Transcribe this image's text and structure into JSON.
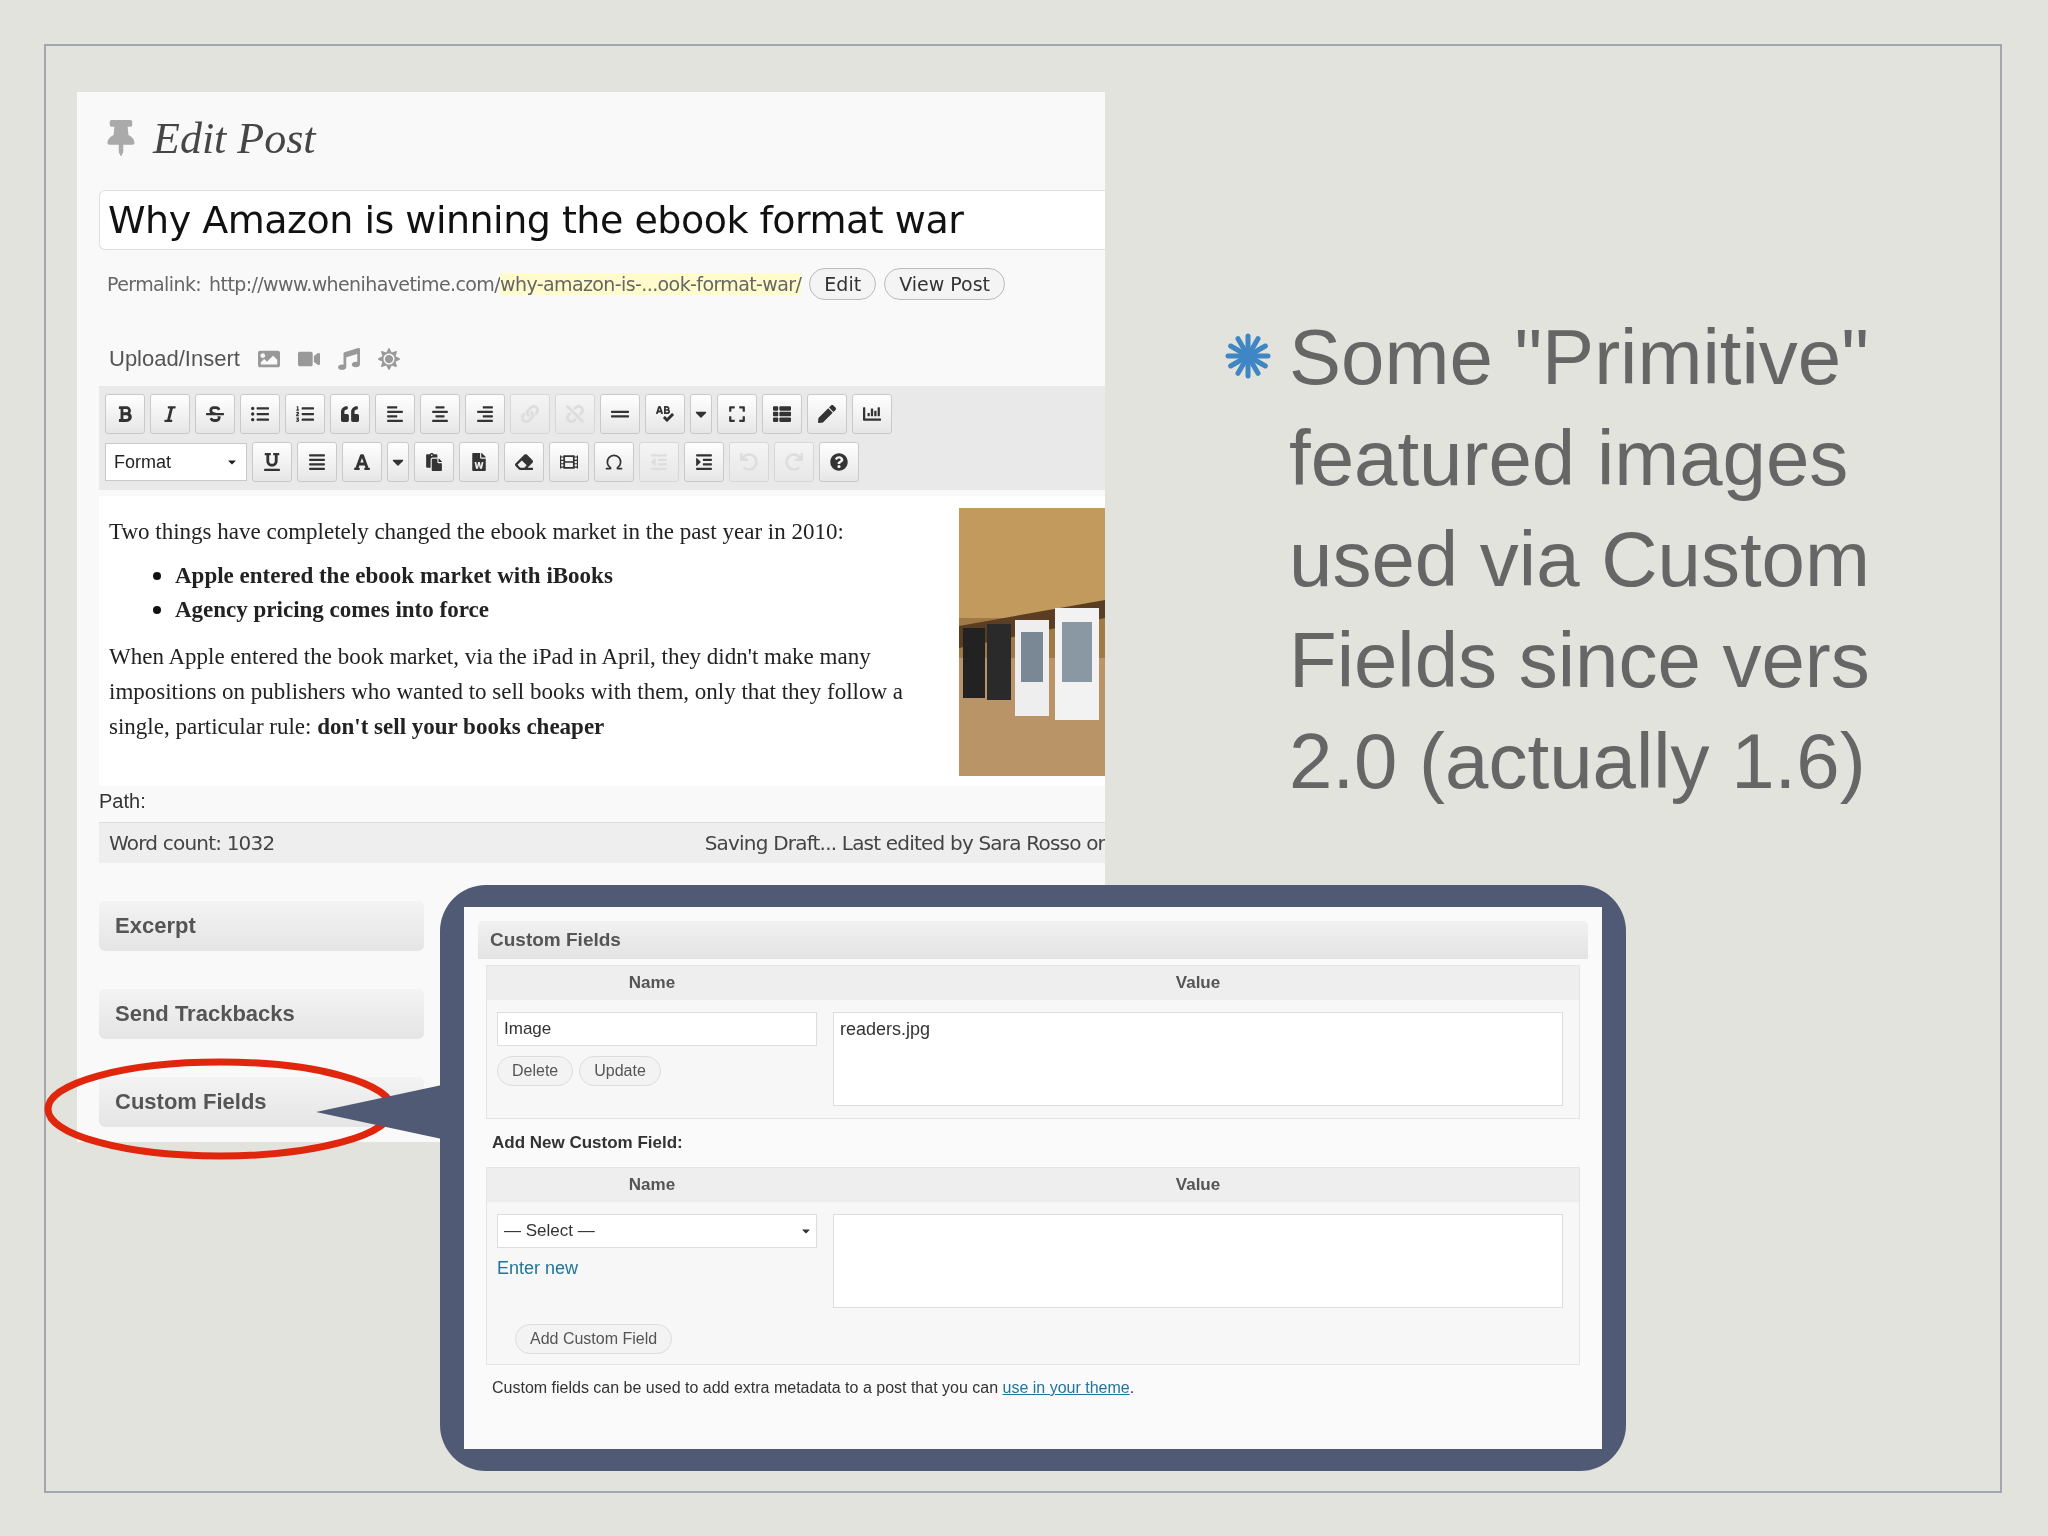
{
  "editor": {
    "heading": "Edit Post",
    "title": "Why Amazon is winning the ebook format war",
    "permalink": {
      "label": "Permalink:",
      "base": "http://www.whenihavetime.com/",
      "slug": "why-amazon-is-...ook-format-war/",
      "buttons": [
        "Edit",
        "View Post"
      ]
    },
    "upload_label": "Upload/Insert",
    "toolbar_rows": [
      [
        {
          "kind": "bold",
          "disabled": false
        },
        {
          "kind": "italic",
          "disabled": false
        },
        {
          "kind": "strike",
          "disabled": false
        },
        {
          "kind": "bullets",
          "disabled": false
        },
        {
          "kind": "numbers",
          "disabled": false
        },
        {
          "kind": "quote",
          "disabled": false
        },
        {
          "kind": "align-left",
          "disabled": false
        },
        {
          "kind": "align-center",
          "disabled": false
        },
        {
          "kind": "align-right",
          "disabled": false
        },
        {
          "kind": "link",
          "disabled": true
        },
        {
          "kind": "unlink",
          "disabled": true
        },
        {
          "kind": "more",
          "disabled": false
        },
        {
          "kind": "spellcheck",
          "disabled": false
        },
        {
          "kind": "dropdown",
          "disabled": false
        },
        {
          "kind": "fullscreen",
          "disabled": false
        },
        {
          "kind": "kitchen-sink",
          "disabled": false
        },
        {
          "kind": "pen",
          "disabled": false
        },
        {
          "kind": "chart",
          "disabled": false
        }
      ],
      [
        {
          "kind": "select",
          "label": "Format"
        },
        {
          "kind": "underline",
          "disabled": false
        },
        {
          "kind": "justify",
          "disabled": false
        },
        {
          "kind": "text-color",
          "disabled": false
        },
        {
          "kind": "dropdown",
          "disabled": false
        },
        {
          "kind": "paste-text",
          "disabled": false
        },
        {
          "kind": "paste-word",
          "disabled": false
        },
        {
          "kind": "eraser",
          "disabled": false
        },
        {
          "kind": "media",
          "disabled": false
        },
        {
          "kind": "omega",
          "disabled": false
        },
        {
          "kind": "outdent",
          "disabled": true
        },
        {
          "kind": "indent",
          "disabled": false
        },
        {
          "kind": "undo",
          "disabled": true
        },
        {
          "kind": "redo",
          "disabled": true
        },
        {
          "kind": "help",
          "disabled": false
        }
      ]
    ],
    "content": {
      "intro": "Two things have completely changed the ebook market in the past year in 2010:",
      "bullets": [
        "Apple entered the ebook market with iBooks",
        "Agency pricing comes into force"
      ],
      "paragraph": "When Apple entered the book market, via the iPad in April, they didn't make many impositions on publishers who wanted to sell books with them, only that they follow a single, particular rule: **don't sell your books cheaper**"
    },
    "path_label": "Path:",
    "word_count": "Word count: 1032",
    "save_status": "Saving Draft... Last edited by Sara Rosso or",
    "boxes": [
      "Excerpt",
      "Send Trackbacks",
      "Custom Fields"
    ]
  },
  "slide_text": "Some \"Primitive\" featured images used via Custom Fields since vers 2.0 (actually 1.6)",
  "custom_fields": {
    "title": "Custom Fields",
    "columns": [
      "Name",
      "Value"
    ],
    "entry": {
      "name": "Image",
      "value": "readers.jpg",
      "buttons": [
        "Delete",
        "Update"
      ]
    },
    "add_label": "Add New Custom Field:",
    "new_columns": [
      "Name",
      "Value"
    ],
    "select": "— Select —",
    "enter_new": "Enter new",
    "add_button": "Add Custom Field",
    "note": "Custom fields can be used to add extra metadata to a post that you can ",
    "note_link": "use in your theme",
    "note_end": "."
  }
}
